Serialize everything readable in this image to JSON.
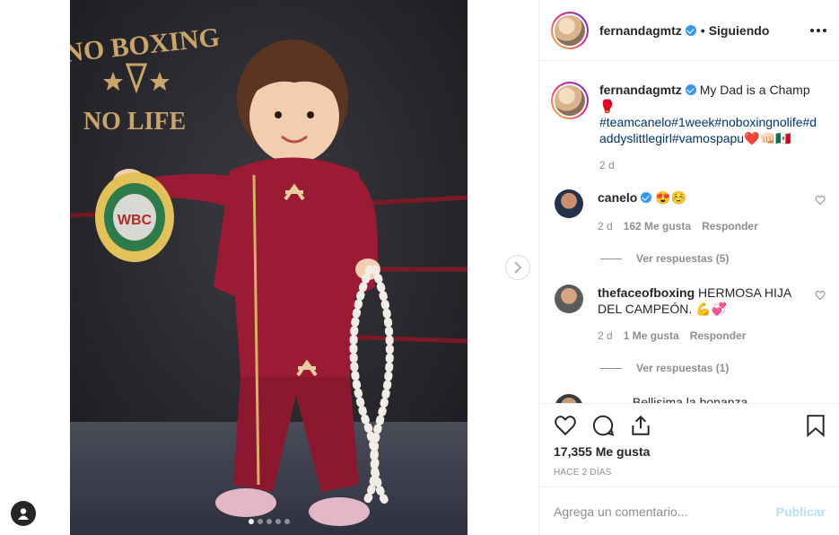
{
  "header": {
    "username": "fernandagmtz",
    "separator": "•",
    "follow_status": "Siguiendo"
  },
  "caption": {
    "username": "fernandagmtz",
    "text": "My Dad is a Champ",
    "emoji_line": "🥊",
    "hashtags_line1": "#teamcanelo#1week#noboxingnolife#d",
    "hashtags_line2": "addyslittlegirl#vamospapu",
    "hashtags_emoji": "❤️👊🏻🇲🇽",
    "time": "2 d"
  },
  "comments": [
    {
      "username": "canelo",
      "text": "😍☺️",
      "time": "2 d",
      "likes": "162 Me gusta",
      "reply": "Responder",
      "view_replies": "Ver respuestas (5)"
    },
    {
      "username": "thefaceofboxing",
      "text": "HERMOSA HIJA DEL CAMPEÓN. 💪💞",
      "time": "2 d",
      "likes": "1 Me gusta",
      "reply": "Responder",
      "view_replies": "Ver respuestas (1)"
    }
  ],
  "partial_comment": "......... Bellisima la bonanza...",
  "likes_count": "17,355 Me gusta",
  "posted_ago": "HACE 2 DÍAS",
  "comment_input": {
    "placeholder": "Agrega un comentario...",
    "value": ""
  },
  "publish_label": "Publicar",
  "photo": {
    "sign_line1": "NO BOXING",
    "sign_line2": "NO LIFE",
    "belt_text": "WBC"
  },
  "carousel": {
    "total": 5,
    "active": 0
  },
  "colors": {
    "link": "#003569",
    "verified": "#3897f0",
    "muted": "#8e8e8e",
    "publish_disabled": "#b2dffc",
    "outfit": "#9b1b35"
  },
  "icons": [
    "heart-icon",
    "comment-icon",
    "share-icon",
    "bookmark-icon",
    "more-options-icon",
    "next-arrow-icon",
    "profile-icon",
    "verified-badge-icon"
  ]
}
